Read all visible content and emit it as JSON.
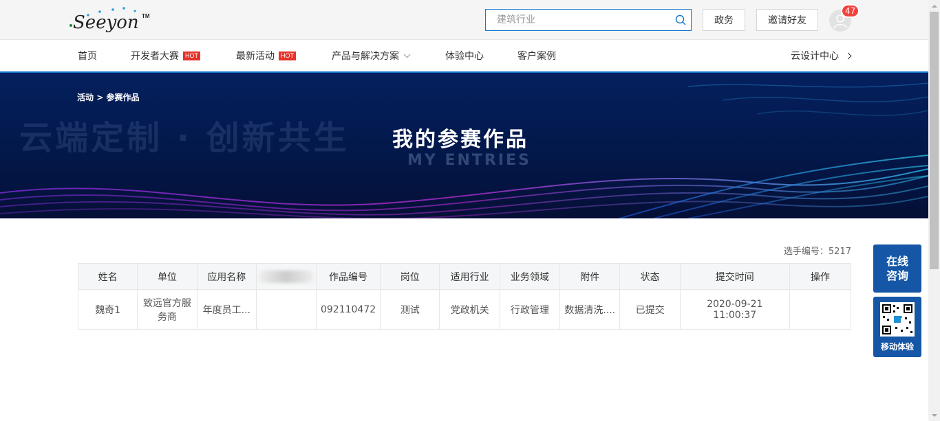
{
  "header": {
    "logo_text": "Seeyon",
    "logo_tm": "TM",
    "search_placeholder": "建筑行业",
    "gov_button": "政务",
    "invite_button": "邀请好友",
    "notification_count": "47"
  },
  "nav": {
    "items": [
      {
        "label": "首页"
      },
      {
        "label": "开发者大赛",
        "badge": "HOT"
      },
      {
        "label": "最新活动",
        "badge": "HOT"
      },
      {
        "label": "产品与解决方案"
      },
      {
        "label": "体验中心"
      },
      {
        "label": "客户案例"
      }
    ],
    "right_link": "云设计中心"
  },
  "banner": {
    "breadcrumb_parent": "活动",
    "breadcrumb_sep": ">",
    "breadcrumb_current": "参赛作品",
    "slogan": "云端定制 · 创新共生",
    "title": "我的参赛作品",
    "subtitle": "MY ENTRIES"
  },
  "content": {
    "player_label": "选手编号：",
    "player_no": "5217",
    "columns": [
      "姓名",
      "单位",
      "应用名称",
      "",
      "作品编号",
      "岗位",
      "适用行业",
      "业务领域",
      "附件",
      "状态",
      "提交时间",
      "操作"
    ],
    "rows": [
      [
        "魏奇1",
        "致远官方服务商",
        "年度员工...",
        "",
        "092110472",
        "测试",
        "党政机关",
        "行政管理",
        "数据清洗....",
        "已提交",
        "2020-09-21 11:00:37",
        ""
      ]
    ]
  },
  "side": {
    "consult_line1": "在线",
    "consult_line2": "咨询",
    "mobile_label": "移动体验"
  },
  "colors": {
    "accent": "#1677cc",
    "hot": "#e6332a",
    "float_blue": "#1557a6",
    "badge_red": "#f2423c"
  }
}
